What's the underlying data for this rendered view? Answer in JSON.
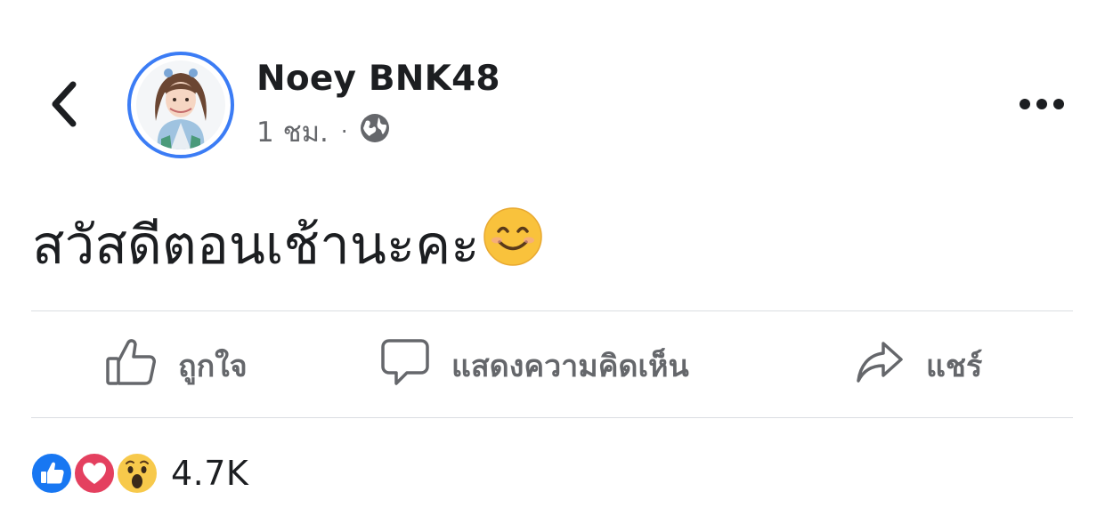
{
  "post": {
    "author": "Noey BNK48",
    "timestamp": "1 ชม.",
    "separator": "·",
    "privacy_icon": "globe-icon",
    "text": "สวัสดีตอนเช้านะคะ",
    "emoji": "smiling-face-with-smiling-eyes"
  },
  "actions": {
    "like_label": "ถูกใจ",
    "comment_label": "แสดงความคิดเห็น",
    "share_label": "แชร์"
  },
  "reactions": {
    "types": [
      "like",
      "love",
      "wow"
    ],
    "count": "4.7K"
  },
  "colors": {
    "accent": "#3b7cf5",
    "like_blue": "#1877f2",
    "love_red": "#e4405f",
    "wow_yellow": "#f7c94b",
    "secondary_text": "#65676b",
    "divider": "#dadde1"
  },
  "icons": {
    "back": "chevron-left-icon",
    "more": "more-horizontal-icon",
    "like": "thumbs-up-icon",
    "comment": "speech-bubble-icon",
    "share": "share-arrow-icon"
  }
}
